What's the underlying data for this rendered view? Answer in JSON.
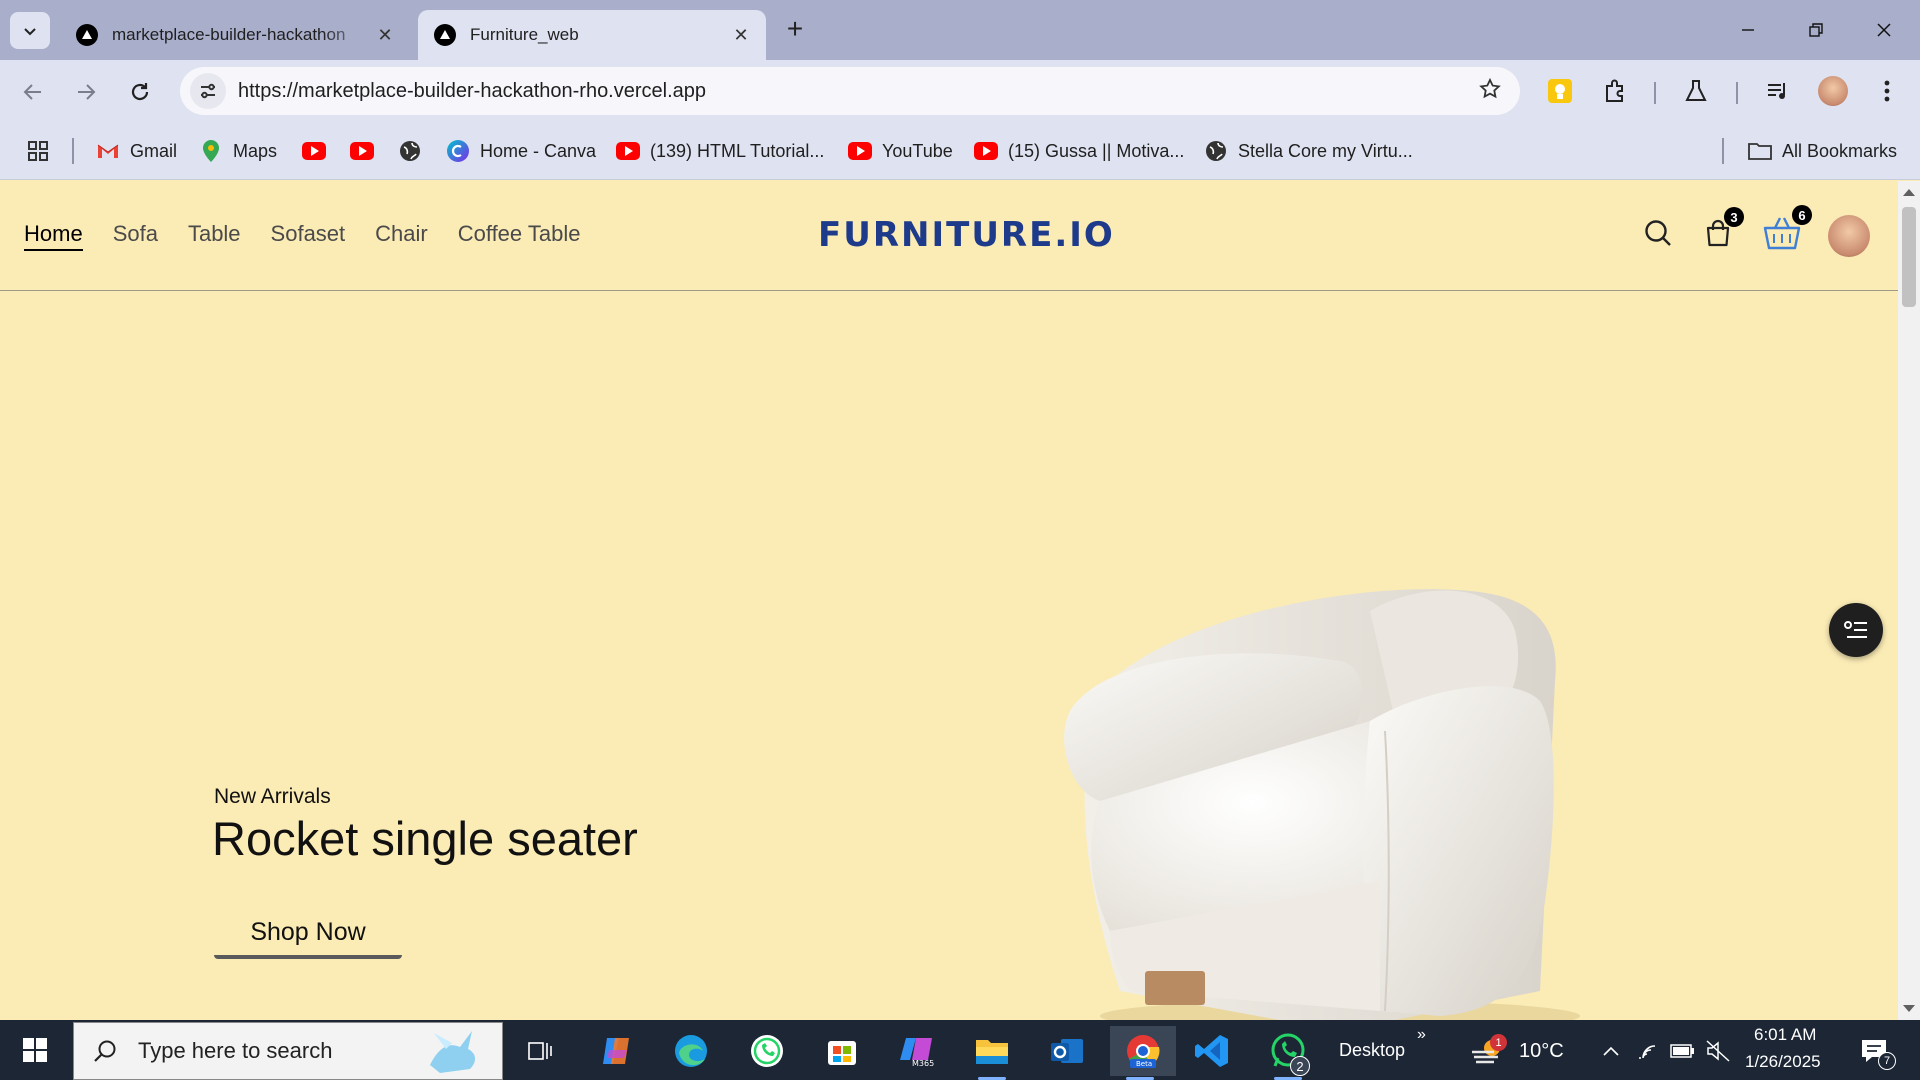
{
  "browser": {
    "tabs": [
      {
        "title": "marketplace-builder-hackathon",
        "active": false
      },
      {
        "title": "Furniture_web",
        "active": true
      }
    ],
    "url": "https://marketplace-builder-hackathon-rho.vercel.app",
    "bookmarks": [
      {
        "label": "Gmail",
        "icon": "gmail-icon"
      },
      {
        "label": "Maps",
        "icon": "maps-icon"
      },
      {
        "label": "",
        "icon": "youtube-icon"
      },
      {
        "label": "",
        "icon": "youtube-icon"
      },
      {
        "label": "",
        "icon": "globe-icon"
      },
      {
        "label": "Home - Canva",
        "icon": "canva-icon"
      },
      {
        "label": "(139) HTML Tutorial...",
        "icon": "youtube-icon"
      },
      {
        "label": "YouTube",
        "icon": "youtube-icon"
      },
      {
        "label": "(15) Gussa || Motiva...",
        "icon": "youtube-icon"
      },
      {
        "label": "Stella Core my Virtu...",
        "icon": "globe-icon"
      }
    ],
    "all_bookmarks": "All Bookmarks"
  },
  "site": {
    "nav": [
      "Home",
      "Sofa",
      "Table",
      "Sofaset",
      "Chair",
      "Coffee Table"
    ],
    "logo": "FURNITURE.IO",
    "bag_count": "3",
    "basket_count": "6",
    "hero": {
      "eyebrow": "New Arrivals",
      "title": "Rocket single seater",
      "cta": "Shop Now"
    },
    "colors": {
      "background": "#fbebb5",
      "logo": "#1e3a8a"
    }
  },
  "taskbar": {
    "search_placeholder": "Type here to search",
    "desktop_label": "Desktop",
    "weather_temp": "10°C",
    "weather_badge": "1",
    "whatsapp_badge": "2",
    "time": "6:01 AM",
    "date": "1/26/2025",
    "notifications": "7"
  }
}
